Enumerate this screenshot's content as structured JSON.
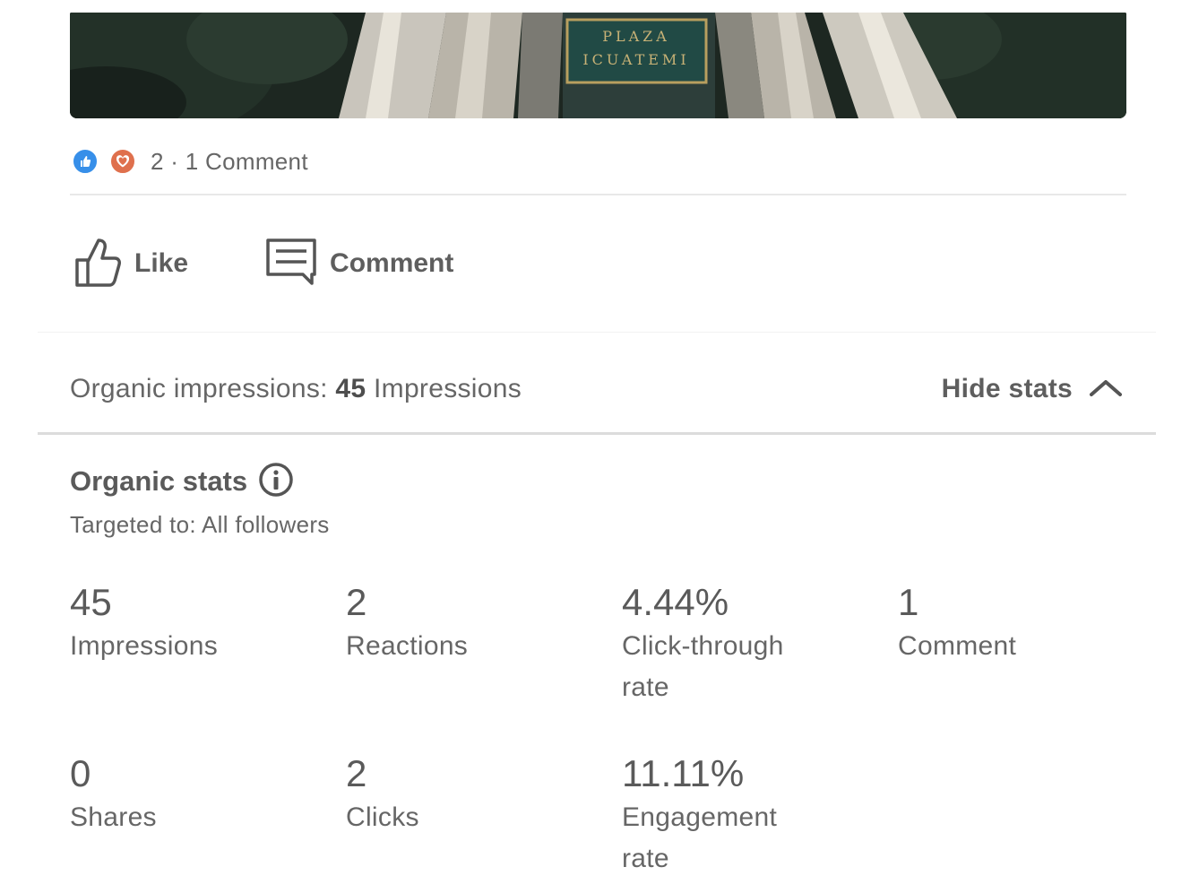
{
  "post": {
    "image": {
      "sign_line1": "PLAZA",
      "sign_line2": "ICUATEMI"
    },
    "reactions": {
      "icons": [
        "like-reaction-icon",
        "love-reaction-icon"
      ],
      "text": "2 · 1 Comment"
    },
    "actions": {
      "like_label": "Like",
      "comment_label": "Comment"
    }
  },
  "impressions": {
    "prefix": "Organic impressions: ",
    "value": "45",
    "suffix": " Impressions",
    "hide_label": "Hide stats"
  },
  "stats": {
    "title": "Organic stats",
    "targeted": "Targeted to: All followers",
    "items": [
      {
        "value": "45",
        "label": "Impressions"
      },
      {
        "value": "2",
        "label": "Reactions"
      },
      {
        "value": "4.44%",
        "label": "Click-through rate"
      },
      {
        "value": "1",
        "label": "Comment"
      },
      {
        "value": "0",
        "label": "Shares"
      },
      {
        "value": "2",
        "label": "Clicks"
      },
      {
        "value": "11.11%",
        "label": "Engagement rate"
      }
    ]
  },
  "colors": {
    "like_blue": "#378fe9",
    "love_orange": "#df704d",
    "text_gray": "#666666",
    "divider": "#dcdcdc"
  }
}
